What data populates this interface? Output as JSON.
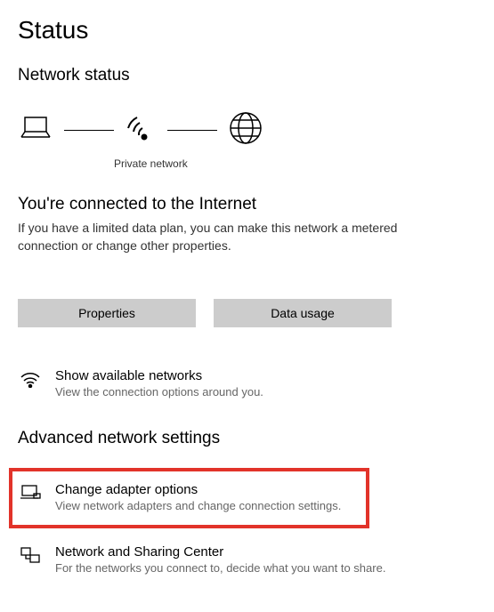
{
  "page_title": "Status",
  "network_status_heading": "Network status",
  "diagram_caption": "Private network",
  "connected_heading": "You're connected to the Internet",
  "connected_desc": "If you have a limited data plan, you can make this network a metered connection or change other properties.",
  "buttons": {
    "properties": "Properties",
    "data_usage": "Data usage"
  },
  "show_networks": {
    "title": "Show available networks",
    "desc": "View the connection options around you."
  },
  "advanced_heading": "Advanced network settings",
  "change_adapter": {
    "title": "Change adapter options",
    "desc": "View network adapters and change connection settings."
  },
  "sharing_center": {
    "title": "Network and Sharing Center",
    "desc": "For the networks you connect to, decide what you want to share."
  }
}
